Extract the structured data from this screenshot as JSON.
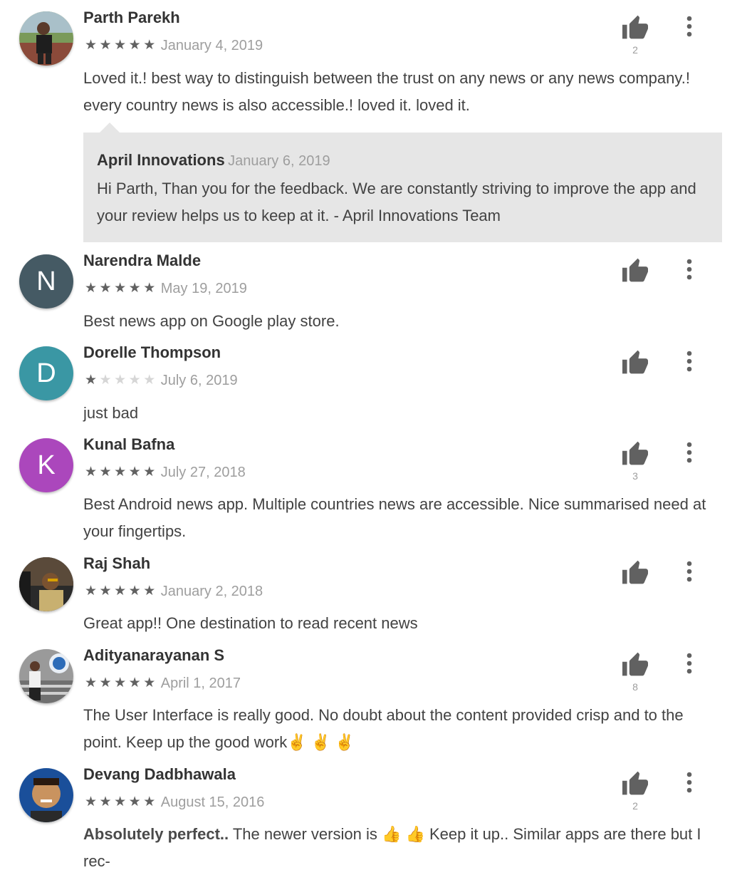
{
  "reviews": [
    {
      "name": "Parth Parekh",
      "rating": 5,
      "date": "January 4, 2019",
      "text": "Loved it.! best way to distinguish between the trust on any news or any news company.! every country news is also accessible.! loved it. loved it.",
      "likes": "2",
      "avatar_letter": "",
      "avatar_color": "#6b8a4a",
      "reply": {
        "name": "April Innovations",
        "date": "January 6, 2019",
        "text": "Hi Parth, Than you for the feedback. We are constantly striving to improve the app and your review helps us to keep at it. - April Innovations Team"
      }
    },
    {
      "name": "Narendra Malde",
      "rating": 5,
      "date": "May 19, 2019",
      "text": "Best news app on Google play store.",
      "likes": "",
      "avatar_letter": "N",
      "avatar_color": "#455a64"
    },
    {
      "name": "Dorelle Thompson",
      "rating": 1,
      "date": "July 6, 2019",
      "text": "just bad",
      "likes": "",
      "avatar_letter": "D",
      "avatar_color": "#3a97a4"
    },
    {
      "name": "Kunal Bafna",
      "rating": 5,
      "date": "July 27, 2018",
      "text": "Best Android news app. Multiple countries news are accessible. Nice summarised need at your fingertips.",
      "likes": "3",
      "avatar_letter": "K",
      "avatar_color": "#ab47bc"
    },
    {
      "name": "Raj Shah",
      "rating": 5,
      "date": "January 2, 2018",
      "text": "Great app!! One destination to read recent news",
      "likes": "",
      "avatar_letter": "",
      "avatar_color": "#3a3a3a"
    },
    {
      "name": "Adityanarayanan S",
      "rating": 5,
      "date": "April 1, 2017",
      "text": "The User Interface is really good. No doubt about the content provided crisp and to the point. Keep up the good work✌ ✌ ✌",
      "likes": "8",
      "avatar_letter": "",
      "avatar_color": "#8a8a8a"
    },
    {
      "name": "Devang Dadbhawala",
      "rating": 5,
      "date": "August 15, 2016",
      "text_bold": "Absolutely perfect..",
      "text": " The newer version is 👍 👍  Keep it up.. Similar apps are there but I rec-",
      "likes": "2",
      "avatar_letter": "",
      "avatar_color": "#1a56a0"
    }
  ]
}
